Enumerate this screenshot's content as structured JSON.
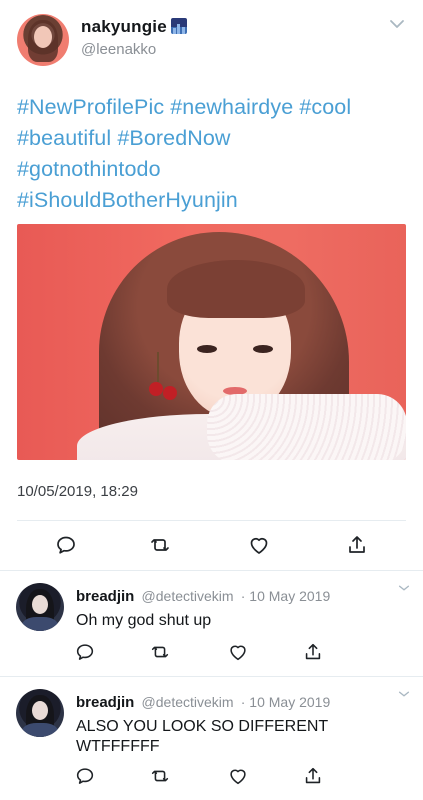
{
  "tweet": {
    "display_name": "nakyungie",
    "name_emoji_icon": "night-city-emoji",
    "handle": "@leenakko",
    "hashtags_line1": "#NewProfilePic #newhairdye #cool",
    "hashtags_line2": "#beautiful #BoredNow",
    "hashtags_line3": "#gotnothintodo",
    "hashtags_line4": "#iShouldBotherHyunjin",
    "timestamp": "10/05/2019, 18:29",
    "icons": [
      "reply-icon",
      "retweet-icon",
      "like-icon",
      "share-icon"
    ]
  },
  "replies": [
    {
      "display_name": "breadjin",
      "handle": "@detectivekim",
      "date": "· 10 May 2019",
      "text": "Oh my god shut up"
    },
    {
      "display_name": "breadjin",
      "handle": "@detectivekim",
      "date": "· 10 May 2019",
      "text": "ALSO YOU LOOK SO DIFFERENT WTFFFFFF"
    }
  ],
  "colors": {
    "hashtag": "#4a9fd4",
    "icon": "#657786",
    "divider": "#e6ecf0"
  }
}
